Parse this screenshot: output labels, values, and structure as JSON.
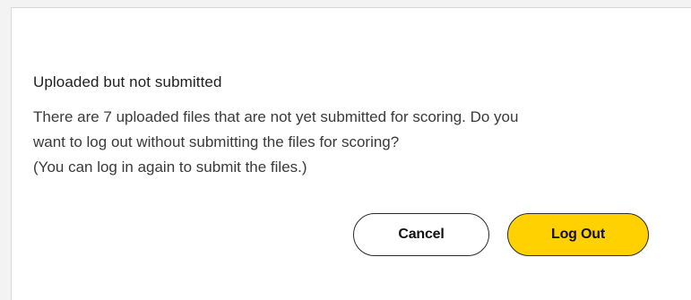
{
  "dialog": {
    "title": "Uploaded but not submitted",
    "message_line1": "There are 7 uploaded files that are not yet submitted for scoring. Do you",
    "message_line2": "want to log out without submitting the files for scoring?",
    "message_line3": "(You can log in again to submit the files.)",
    "cancel_label": "Cancel",
    "logout_label": "Log Out"
  },
  "colors": {
    "primary_button": "#ffd100",
    "secondary_button": "#ffffff",
    "button_border": "#2a2a2a"
  }
}
